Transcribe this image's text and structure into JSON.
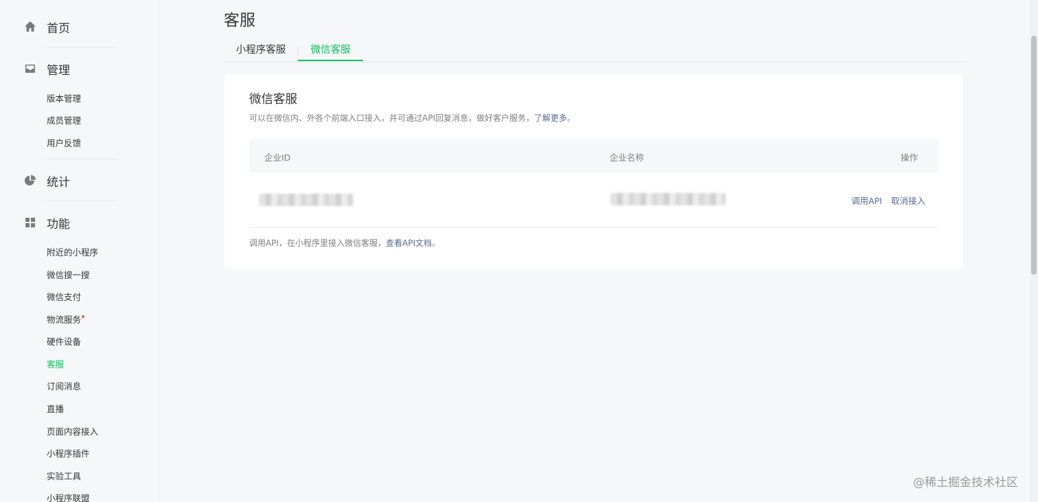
{
  "sidebar": {
    "home": "首页",
    "manage": {
      "title": "管理",
      "items": [
        "版本管理",
        "成员管理",
        "用户反馈"
      ]
    },
    "stats": "统计",
    "features": {
      "title": "功能",
      "items": [
        "附近的小程序",
        "微信搜一搜",
        "微信支付",
        "物流服务",
        "硬件设备",
        "客服",
        "订阅消息",
        "直播",
        "页面内容接入",
        "小程序插件",
        "实验工具",
        "小程序联盟"
      ]
    }
  },
  "page_title": "客服",
  "tabs": [
    "小程序客服",
    "微信客服"
  ],
  "card": {
    "title": "微信客服",
    "desc": "可以在微信内、外各个前端入口接入，并可通过API回复消息，做好客户服务，",
    "desc_link": "了解更多",
    "desc_end": "。",
    "table": {
      "headers": [
        "企业ID",
        "企业名称",
        "操作"
      ],
      "actions": [
        "调用API",
        "取消接入"
      ]
    },
    "foot": "调用API，在小程序里接入微信客服，",
    "foot_link": "查看API文档",
    "foot_end": "。"
  },
  "watermark": "@稀土掘金技术社区",
  "colors": {
    "accent": "#07c160",
    "link": "#576b95"
  }
}
